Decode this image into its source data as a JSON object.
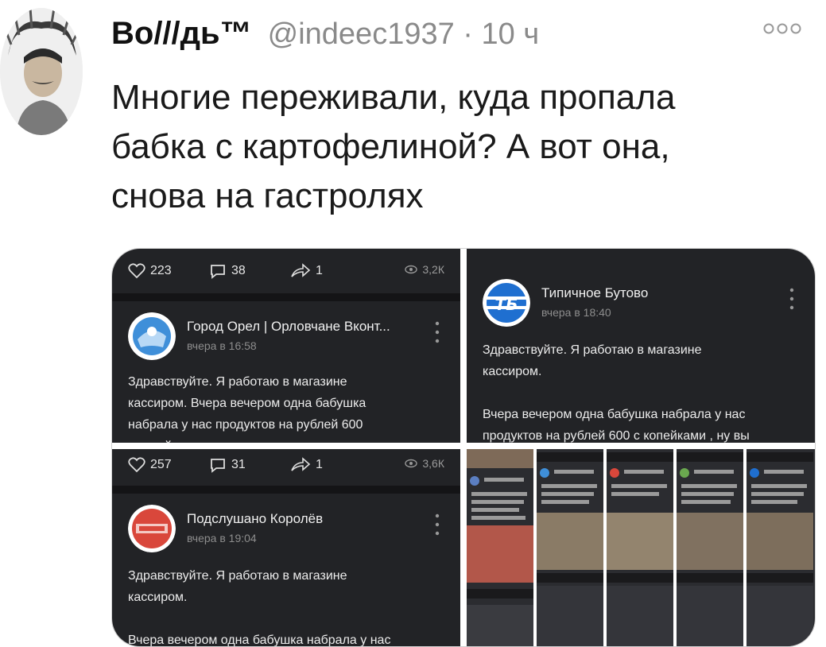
{
  "tweet": {
    "author_name": "Во///дь™",
    "handle": "@indeec1937 · 10 ч",
    "text_lines": [
      "Многие переживали, куда пропала",
      "бабка с картофелиной? А вот она,",
      "снова на гастролях"
    ]
  },
  "screenshots": [
    {
      "likes": "223",
      "comments": "38",
      "shares": "1",
      "views": "3,2К",
      "source": "Город Орел | Орловчане Вконт...",
      "time": "вчера в 16:58",
      "text_lines": [
        "Здравствуйте. Я работаю в магазине",
        "кассиром. Вчера вечером одна бабушка",
        "набрала у нас продуктов на рублей 600",
        "с копейками , ну вы знаете там самое"
      ]
    },
    {
      "source": "Типичное Бутово",
      "time": "вчера в 18:40",
      "logo_text": "ТБ",
      "text_lines": [
        "Здравствуйте. Я работаю в магазине",
        "кассиром.",
        "",
        "Вчера вечером одна бабушка набрала у нас",
        "продуктов на рублей 600 с копейками , ну вы"
      ]
    },
    {
      "likes": "257",
      "comments": "31",
      "shares": "1",
      "views": "3,6К",
      "source": "Подслушано Королёв",
      "time": "вчера в 19:04",
      "text_lines": [
        "Здравствуйте. Я работаю в магазине",
        "кассиром.",
        "",
        "Вчера вечером одна бабушка набрала у нас"
      ]
    }
  ],
  "colors": {
    "panel_bg": "#222326",
    "accent_blue": "#1f6fd0",
    "accent_red": "#d9473b"
  }
}
